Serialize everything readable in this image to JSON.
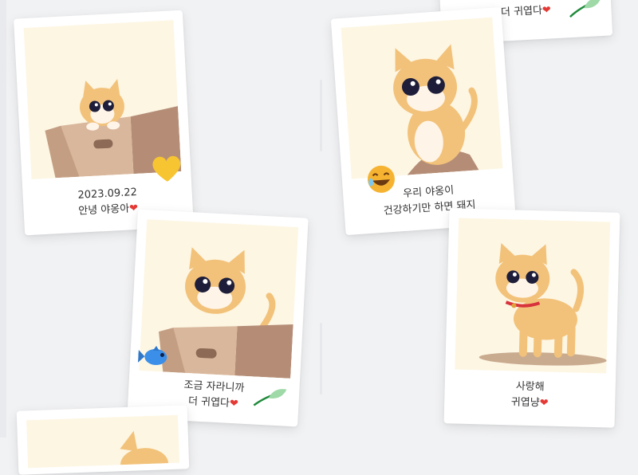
{
  "photos": [
    {
      "line1": "2023.09.22",
      "line2": "안녕 야옹아"
    },
    {
      "line1": "우리 야옹이",
      "line2": "건강하기만 하면 돼지"
    },
    {
      "line1": "조금 자라니까",
      "line2": "더 귀엽다"
    },
    {
      "line1": "사랑해",
      "line2": "귀엽냥"
    },
    {
      "line1": "",
      "line2": "더 귀엽다"
    }
  ],
  "colors": {
    "heart": "#e53935",
    "photo_bg": "#fdf6e3",
    "cat": "#f2c27a",
    "box": "#c8a68a"
  },
  "icons": [
    "heart-icon",
    "yellow-heart-sticker",
    "laughing-emoji-sticker",
    "fish-sticker",
    "leaf-sticker"
  ]
}
